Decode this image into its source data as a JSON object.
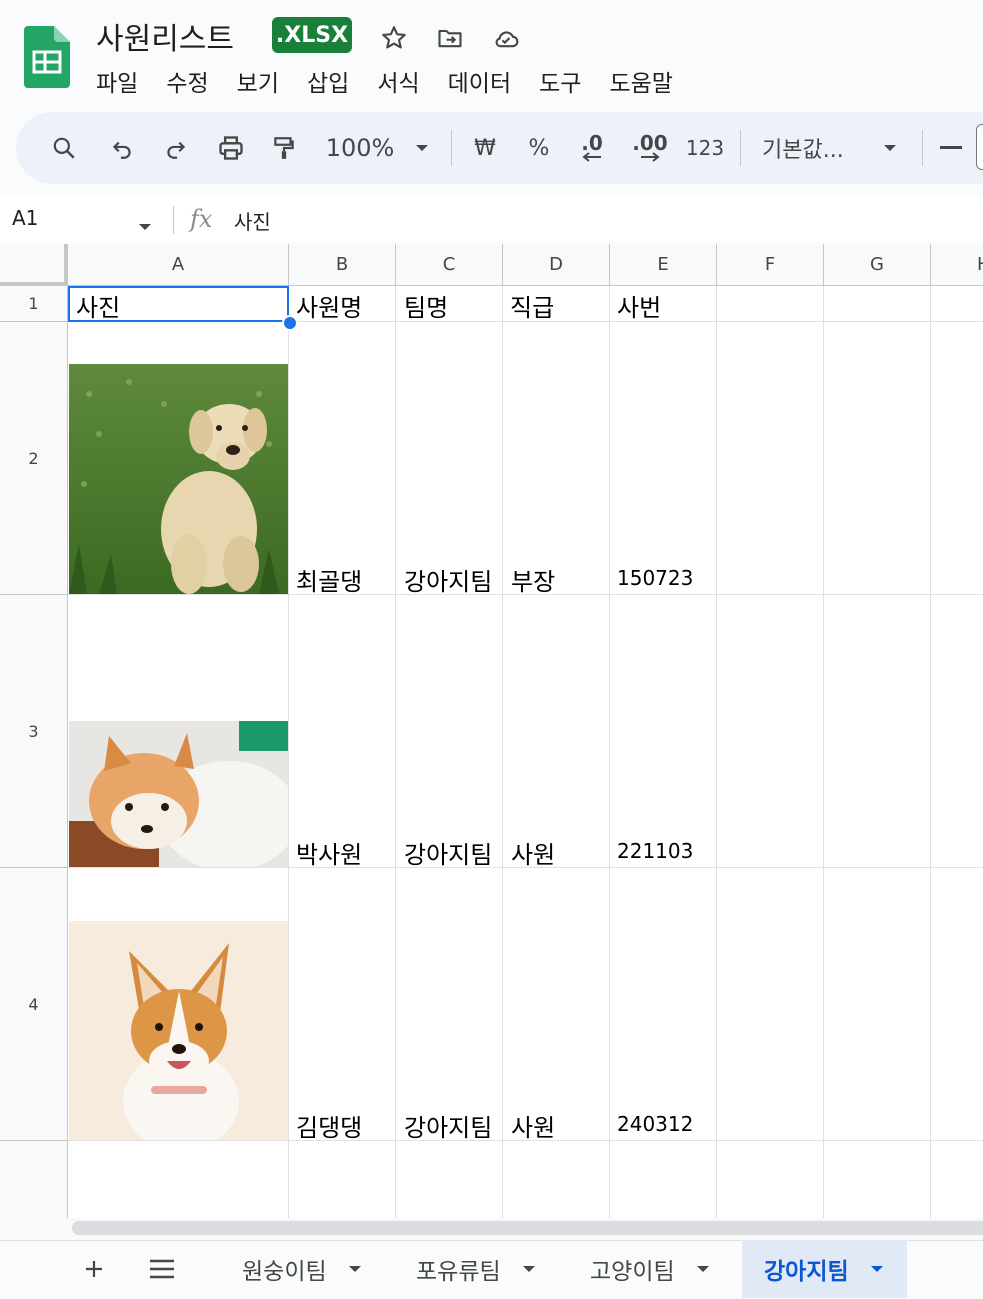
{
  "header": {
    "title": "사원리스트",
    "badge": ".XLSX",
    "icons": [
      "star-icon",
      "move-folder-icon",
      "cloud-saved-icon"
    ]
  },
  "menu": [
    "파일",
    "수정",
    "보기",
    "삽입",
    "서식",
    "데이터",
    "도구",
    "도움말"
  ],
  "toolbar": {
    "zoom": "100%",
    "currency": "₩",
    "percent": "%",
    "decrease_decimal": ".0",
    "increase_decimal": ".00",
    "number_format": "123",
    "font": "기본값..."
  },
  "formula_bar": {
    "name_box": "A1",
    "fx": "fx",
    "content": "사진"
  },
  "columns": [
    "A",
    "B",
    "C",
    "D",
    "E",
    "F",
    "G",
    "H"
  ],
  "rows": [
    "1",
    "2",
    "3",
    "4"
  ],
  "table": {
    "headers": [
      "사진",
      "사원명",
      "팀명",
      "직급",
      "사번"
    ],
    "rows": [
      {
        "name": "최골댕",
        "team": "강아지팀",
        "rank": "부장",
        "id": "150723",
        "photo": "labrador-photo"
      },
      {
        "name": "박사원",
        "team": "강아지팀",
        "rank": "사원",
        "id": "221103",
        "photo": "pomeranian-photo"
      },
      {
        "name": "김댕댕",
        "team": "강아지팀",
        "rank": "사원",
        "id": "240312",
        "photo": "corgi-photo"
      }
    ]
  },
  "sheet_tabs": [
    "원숭이팀",
    "포유류팀",
    "고양이팀",
    "강아지팀"
  ],
  "active_tab": "강아지팀",
  "colors": {
    "accent": "#1a73e8",
    "badge": "#188038",
    "active_tab_text": "#0b57d0"
  }
}
